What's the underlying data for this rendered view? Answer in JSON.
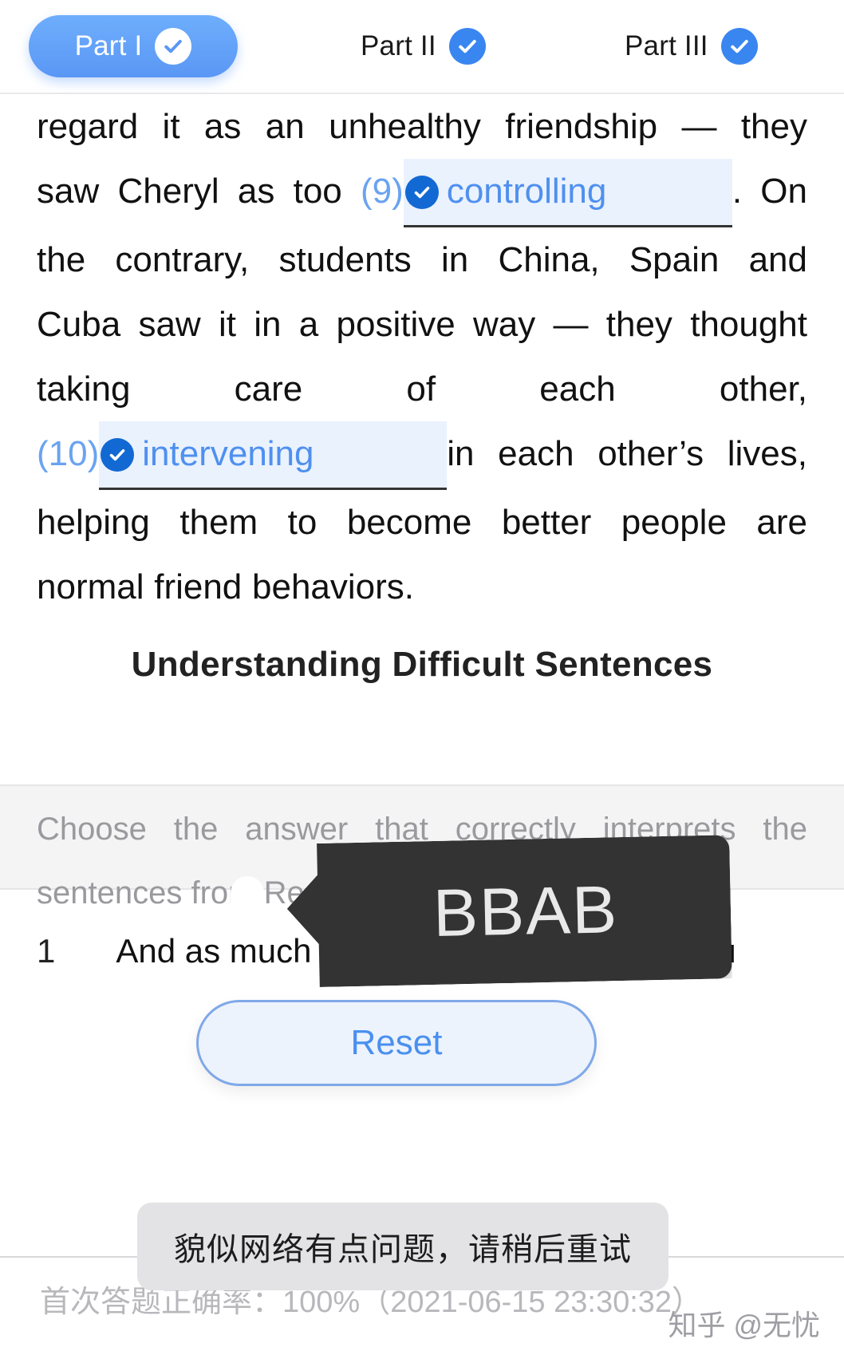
{
  "tabs": [
    {
      "label": "Part I",
      "state": "active",
      "icon": "check-circle-icon"
    },
    {
      "label": "Part II",
      "state": "complete",
      "icon": "check-circle-icon"
    },
    {
      "label": "Part III",
      "state": "complete",
      "icon": "check-circle-icon"
    }
  ],
  "passage": {
    "line1": "regard it as an unhealthy friendship — they",
    "line2_pre": "saw Cheryl as too ",
    "blank9_num": "(9)",
    "blank9_word": "controlling",
    "line2_post": ". On",
    "line3": "the contrary, students in China, Spain and",
    "line4": "Cuba saw it in a positive way — they thought",
    "line5": "taking care of each other,",
    "blank10_num": "(10)",
    "blank10_word": "intervening",
    "line6_post": "in each other’s lives,",
    "line7": "helping them to become better people are",
    "line8": "normal friend behaviors."
  },
  "section": {
    "title": "Understanding Difficult Sentences",
    "instruction_line1": "Choose the answer that correctly interprets the",
    "instruction_line2": "sentences from Reading 1."
  },
  "question": {
    "number": "1",
    "text": "And as much as you love this person, you"
  },
  "tooltip": {
    "text": "BBAB"
  },
  "reset": {
    "label": "Reset"
  },
  "toast": {
    "message": "貌似网络有点问题，请稍后重试"
  },
  "footer": {
    "stat": "首次答题正确率：100%（2021-06-15 23:30:32）",
    "watermark": "知乎 @无忧"
  },
  "colors": {
    "accent": "#5a97f5",
    "blank_text": "#4f90ef",
    "blank_bg": "#eaf2fe",
    "check_blue": "#3a86f0",
    "tooltip_bg": "#333333",
    "toast_bg": "#e3e3e5",
    "instruction_bg": "#f4f4f5",
    "muted_text": "#9a9a9e"
  }
}
